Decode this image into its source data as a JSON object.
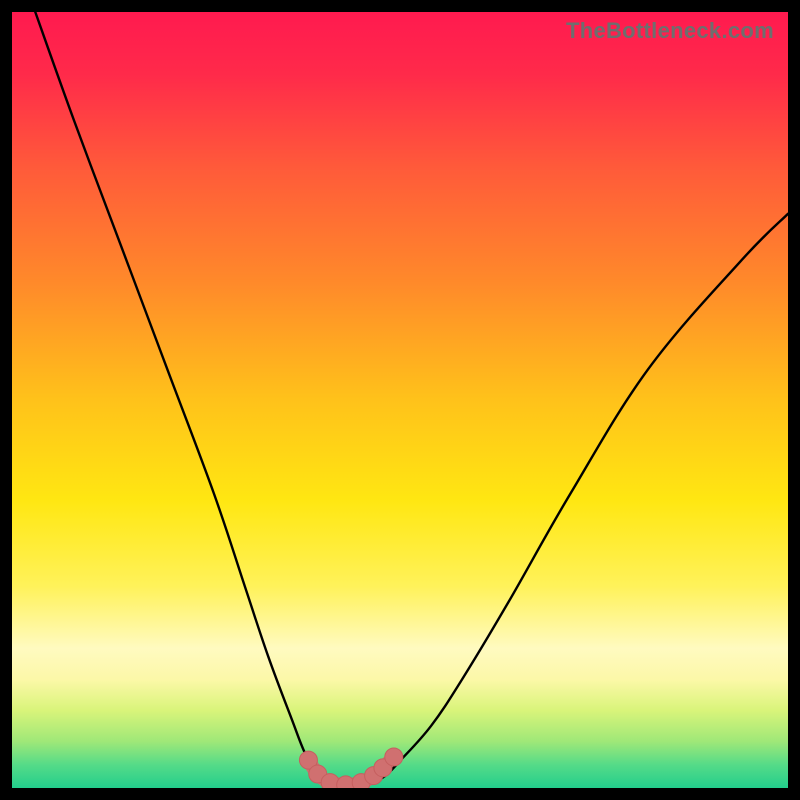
{
  "watermark": "TheBottleneck.com",
  "colors": {
    "frame": "#000000",
    "gradient_stops": [
      {
        "offset": 0.0,
        "color": "#ff1a4f"
      },
      {
        "offset": 0.08,
        "color": "#ff2a4a"
      },
      {
        "offset": 0.2,
        "color": "#ff5a3a"
      },
      {
        "offset": 0.35,
        "color": "#ff8a2a"
      },
      {
        "offset": 0.5,
        "color": "#ffc21a"
      },
      {
        "offset": 0.63,
        "color": "#ffe712"
      },
      {
        "offset": 0.74,
        "color": "#fff25a"
      },
      {
        "offset": 0.82,
        "color": "#fffac0"
      },
      {
        "offset": 0.86,
        "color": "#fcf8a8"
      },
      {
        "offset": 0.9,
        "color": "#d9f47a"
      },
      {
        "offset": 0.94,
        "color": "#9fe878"
      },
      {
        "offset": 0.97,
        "color": "#55db88"
      },
      {
        "offset": 1.0,
        "color": "#23ce8c"
      }
    ],
    "curve": "#000000",
    "markers_fill": "#d07070",
    "markers_stroke": "#c55f5f"
  },
  "chart_data": {
    "type": "line",
    "title": "",
    "xlabel": "",
    "ylabel": "",
    "xlim": [
      0,
      100
    ],
    "ylim": [
      0,
      100
    ],
    "grid": false,
    "legend": false,
    "series": [
      {
        "name": "bottleneck-curve",
        "x": [
          3,
          8,
          14,
          20,
          26,
          30,
          33,
          36,
          38,
          40,
          42,
          44,
          46,
          48,
          50,
          54,
          58,
          64,
          72,
          82,
          94,
          100
        ],
        "y": [
          100,
          86,
          70,
          54,
          38,
          26,
          17,
          9,
          4,
          1.5,
          0.6,
          0.4,
          0.6,
          1.5,
          3.5,
          8,
          14,
          24,
          38,
          54,
          68,
          74
        ]
      }
    ],
    "markers": {
      "name": "trough-markers",
      "x": [
        38.2,
        39.4,
        41.0,
        43.0,
        45.0,
        46.6,
        47.8,
        49.2
      ],
      "y": [
        3.6,
        1.8,
        0.7,
        0.4,
        0.7,
        1.6,
        2.6,
        4.0
      ]
    }
  }
}
